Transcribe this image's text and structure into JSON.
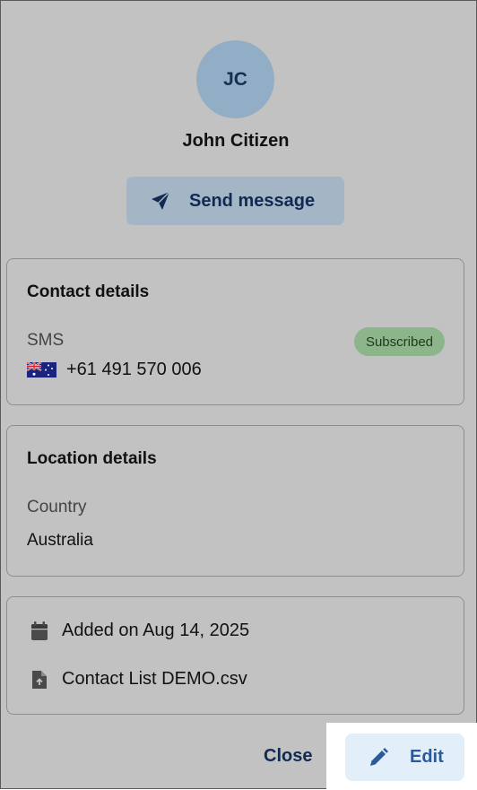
{
  "contact": {
    "initials": "JC",
    "name": "John Citizen"
  },
  "actions": {
    "send_message_label": "Send message",
    "close_label": "Close",
    "edit_label": "Edit"
  },
  "contact_details": {
    "title": "Contact details",
    "channel_label": "SMS",
    "status_badge": "Subscribed",
    "phone": "+61 491 570 006",
    "flag_icon": "australia-flag-icon"
  },
  "location_details": {
    "title": "Location details",
    "country_label": "Country",
    "country_value": "Australia"
  },
  "meta": {
    "added_on": "Added on Aug 14, 2025",
    "source_file": "Contact List DEMO.csv"
  },
  "colors": {
    "overlay": "#c2c2c2",
    "primary_text": "#112a52",
    "badge_bg": "#8db58c",
    "edit_bg": "#e2eff9"
  }
}
